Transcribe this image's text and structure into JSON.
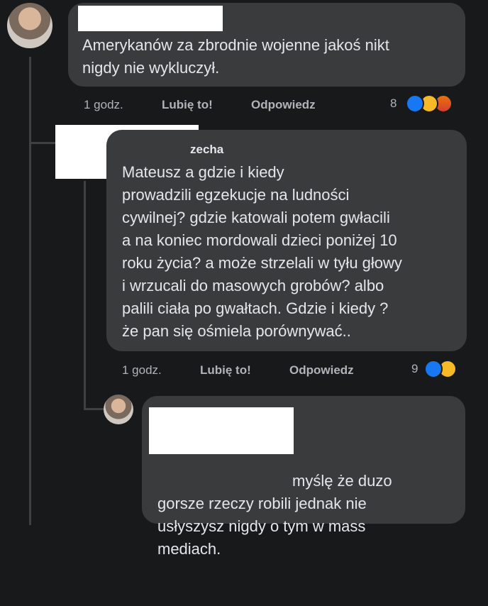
{
  "comments": [
    {
      "text": "Amerykanów za zbrodnie wojenne jakoś nikt\nnigdy nie wykluczył.",
      "time": "1 godz.",
      "like_label": "Lubię to!",
      "reply_label": "Odpowiedz",
      "reaction_count": "8",
      "reactions": [
        "like-icon",
        "haha-icon",
        "angry-icon"
      ]
    },
    {
      "name_fragment": "zecha",
      "text": "Mateusz a gdzie i kiedy\nprowadzili egzekucje na ludności\ncywilnej? gdzie katowali potem gwłacili\na na koniec mordowali dzieci poniżej 10\nroku życia? a może strzelali w tyłu głowy\ni wrzucali do masowych grobów? albo\npalili ciała po gwałtach. Gdzie i kiedy ?\nże pan się ośmiela porównywać..",
      "time": "1 godz.",
      "like_label": "Lubię to!",
      "reply_label": "Odpowiedz",
      "reaction_count": "9",
      "reactions": [
        "like-icon",
        "haha-icon"
      ]
    },
    {
      "text": "myślę że duzo\ngorsze rzeczy robili jednak nie\nusłyszysz nigdy o tym w mass\nmediach."
    }
  ],
  "colors": {
    "background": "#18191a",
    "bubble": "#3a3b3c",
    "like": "#1877f2",
    "haha": "#f7b928",
    "angry": "#e9710f"
  }
}
